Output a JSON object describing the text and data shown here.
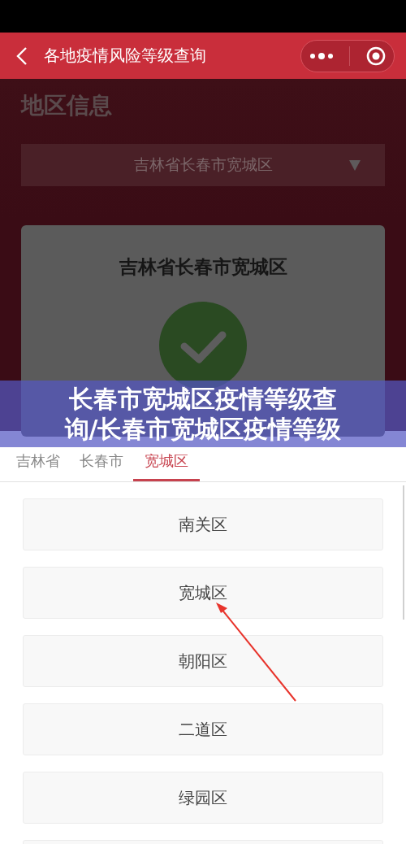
{
  "nav": {
    "title": "各地疫情风险等级查询"
  },
  "section_title": "地区信息",
  "region_select": {
    "value": "吉林省长春市宽城区"
  },
  "result_card": {
    "region": "吉林省长春市宽城区"
  },
  "banner": {
    "text": "长春市宽城区疫情等级查询/长春市宽城区疫情等级"
  },
  "tabs": [
    {
      "label": "吉林省",
      "selected": false
    },
    {
      "label": "长春市",
      "selected": false
    },
    {
      "label": "宽城区",
      "selected": true
    }
  ],
  "districts": [
    {
      "name": "南关区"
    },
    {
      "name": "宽城区"
    },
    {
      "name": "朝阳区"
    },
    {
      "name": "二道区"
    },
    {
      "name": "绿园区"
    }
  ]
}
